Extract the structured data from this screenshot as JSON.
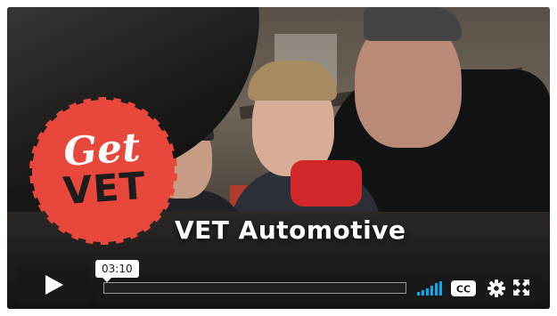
{
  "video": {
    "title": "VET Automotive",
    "badge": {
      "line1": "Get",
      "line2": "VET"
    }
  },
  "controls": {
    "time_tooltip": "03:10",
    "progress_fraction": 0.0,
    "cc_label": "CC",
    "icons": [
      "play-icon",
      "volume-icon",
      "closed-captions-icon",
      "gear-icon",
      "fullscreen-icon"
    ]
  },
  "colors": {
    "badge": "#e8483c",
    "accent": "#00adef",
    "control_bg": "#181818"
  }
}
